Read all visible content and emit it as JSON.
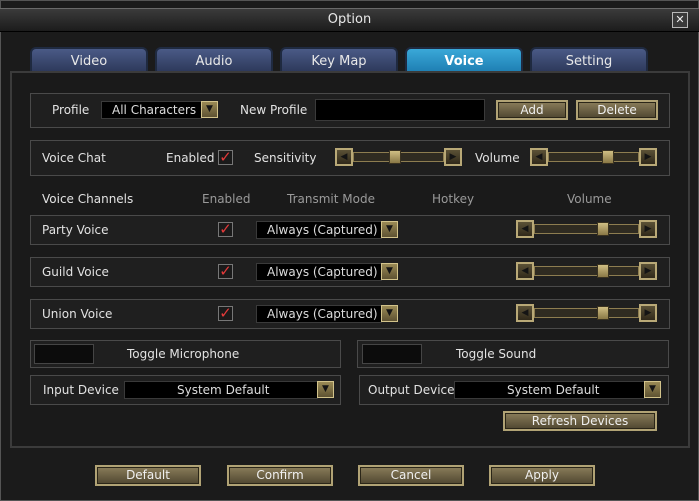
{
  "window": {
    "title": "Option",
    "close_label": "✕"
  },
  "tabs": [
    {
      "label": "Video",
      "active": false
    },
    {
      "label": "Audio",
      "active": false
    },
    {
      "label": "Key Map",
      "active": false
    },
    {
      "label": "Voice",
      "active": true
    },
    {
      "label": "Setting",
      "active": false
    }
  ],
  "profile": {
    "label": "Profile",
    "selected": "All Characters",
    "new_profile_label": "New Profile",
    "new_profile_value": "",
    "add_label": "Add",
    "delete_label": "Delete"
  },
  "voice_chat": {
    "label": "Voice Chat",
    "enabled_label": "Enabled",
    "enabled": true,
    "sensitivity_label": "Sensitivity",
    "sensitivity_level": 0.45,
    "volume_label": "Volume",
    "volume_level": 0.68
  },
  "channels_header": {
    "voice_channels": "Voice Channels",
    "enabled": "Enabled",
    "transmit_mode": "Transmit Mode",
    "hotkey": "Hotkey",
    "volume": "Volume"
  },
  "channels": [
    {
      "name": "Party Voice",
      "enabled": true,
      "mode": "Always (Captured)",
      "hotkey": "",
      "volume_level": 0.68
    },
    {
      "name": "Guild Voice",
      "enabled": true,
      "mode": "Always (Captured)",
      "hotkey": "",
      "volume_level": 0.68
    },
    {
      "name": "Union Voice",
      "enabled": true,
      "mode": "Always (Captured)",
      "hotkey": "",
      "volume_level": 0.68
    }
  ],
  "toggles": {
    "microphone_label": "Toggle Microphone",
    "microphone_key": "",
    "sound_label": "Toggle Sound",
    "sound_key": ""
  },
  "devices": {
    "input_label": "Input Device",
    "input_value": "System Default",
    "output_label": "Output Device",
    "output_value": "System Default",
    "refresh_label": "Refresh Devices"
  },
  "footer": {
    "default_label": "Default",
    "confirm_label": "Confirm",
    "cancel_label": "Cancel",
    "apply_label": "Apply"
  },
  "icons": {
    "check": "✓",
    "dropdown": "▼",
    "left": "◀",
    "right": "▶"
  },
  "colors": {
    "active_tab": "#2a96c8",
    "inactive_tab": "#3c4a72",
    "button_gold": "#b1a375",
    "check_red": "#e23a3a"
  }
}
